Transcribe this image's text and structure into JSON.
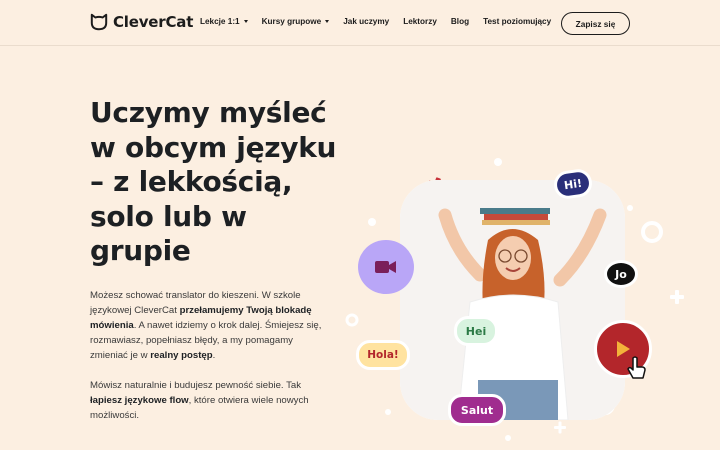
{
  "brand": {
    "name": "CleverCat",
    "accent": "#1c1c1c"
  },
  "nav": {
    "items": [
      {
        "label": "Lekcje 1:1",
        "dropdown": true
      },
      {
        "label": "Kursy grupowe",
        "dropdown": true
      },
      {
        "label": "Jak uczymy",
        "dropdown": false
      },
      {
        "label": "Lektorzy",
        "dropdown": false
      },
      {
        "label": "Blog",
        "dropdown": false
      },
      {
        "label": "Test poziomujący",
        "dropdown": false
      }
    ],
    "cta_label": "Zapisz się"
  },
  "hero": {
    "title_lines": [
      "Uczymy myśleć",
      "w obcym języku",
      "– z lekkością,",
      "solo lub w",
      "grupie"
    ],
    "p1": {
      "t1": "Możesz schować translator do kieszeni. W szkole językowej CleverCat ",
      "b1": "przełamujemy Twoją blokadę mówienia",
      "t2": ". A nawet idziemy o krok dalej. Śmiejesz się, rozmawiasz, popełniasz błędy, a my pomagamy zmieniać je w ",
      "b2": "realny postęp",
      "t3": "."
    },
    "p2": {
      "t1": "Mówisz naturalnie i budujesz pewność siebie. Tak ",
      "b1": "łapiesz językowe flow",
      "t2": ", które otwiera wiele nowych możliwości."
    }
  },
  "bubbles": {
    "hi": "Hi!",
    "jo": "Jo",
    "hei": "Hei",
    "hola": "Hola!",
    "salut": "Salut"
  },
  "colors": {
    "background": "#fcefe1",
    "navy": "#2a2f7a",
    "purple": "#b9a6f7",
    "red": "#b3262b",
    "pink": "#d65a7a",
    "magenta": "#a02d8f",
    "green_bg": "#d8f3df",
    "green_text": "#2b7a45",
    "yellow_bg": "#ffe3a0",
    "yellow_text": "#b3262b"
  },
  "icons": [
    "cat-logo-icon",
    "chevron-down-icon",
    "video-camera-icon",
    "play-icon",
    "cursor-hand-icon",
    "plus-icon",
    "ring-icon"
  ]
}
